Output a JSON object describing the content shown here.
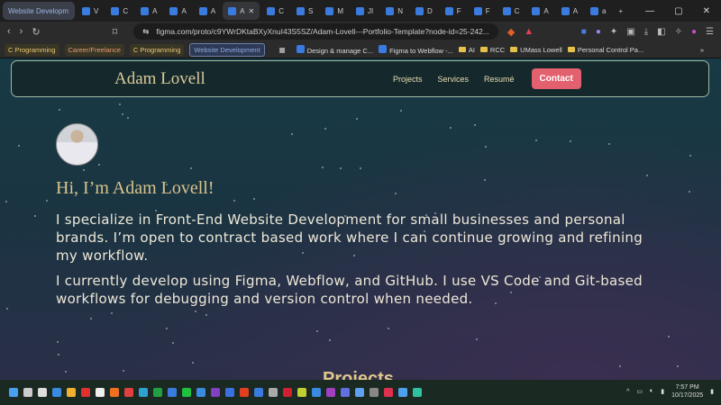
{
  "browser": {
    "tabs": [
      "Website Developm",
      "V",
      "C",
      "A",
      "A",
      "A",
      "A",
      "C",
      "S",
      "M",
      "JI",
      "N",
      "D",
      "F",
      "F",
      "C",
      "A",
      "A",
      "a"
    ],
    "active_tab_index": 0,
    "current_tab_index": 6,
    "url": "figma.com/proto/c9YWrDKtaBXyXnuI43S5SZ/Adam-Lovell---Portfolio-Template?node-id=25-242...",
    "window_controls": [
      "—",
      "▢",
      "✕"
    ],
    "new_tab": "+",
    "bookmarks": [
      {
        "label": "C Programming",
        "color": "#e8c872",
        "type": "chip"
      },
      {
        "label": "Career/Freelance",
        "color": "#e89a72",
        "type": "chip"
      },
      {
        "label": "C Programming",
        "color": "#e8c872",
        "type": "chip"
      },
      {
        "label": "Website Development",
        "color": "#8fa8e0",
        "type": "chip"
      },
      {
        "label": "Design & manage C...",
        "type": "link"
      },
      {
        "label": "Figma to Webflow -...",
        "type": "link"
      },
      {
        "label": "AI",
        "type": "folder"
      },
      {
        "label": "RCC",
        "type": "folder"
      },
      {
        "label": "UMass Lowell",
        "type": "folder"
      },
      {
        "label": "Personal Control Pa...",
        "type": "folder"
      }
    ],
    "more": "»"
  },
  "site": {
    "brand": "Adam Lovell",
    "nav": [
      "Projects",
      "Services",
      "Resumé"
    ],
    "contact": "Contact",
    "greeting": "Hi, I’m Adam Lovell!",
    "para1": "I specialize in Front-End Website Development for small businesses and personal brands. I’m open to contract based work where I can continue growing and refining my workflow.",
    "para2": "I currently develop using Figma, Webflow, and GitHub. I use VS Code and Git-based workflows for debugging and version control when needed.",
    "next_section": "Projects",
    "accent": "#e3606e"
  },
  "taskbar": {
    "time": "7:57 PM",
    "date": "10/17/2025"
  }
}
